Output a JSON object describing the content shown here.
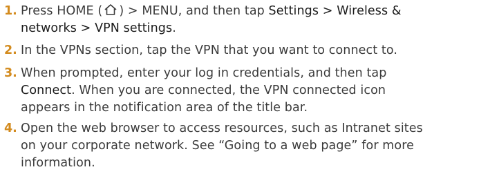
{
  "heading_fragment": "",
  "steps": [
    {
      "number": "1.",
      "line1": {
        "a": "Press HOME (",
        "icon": "home-icon",
        "b": ") > MENU, and then tap ",
        "c": "Settings > Wireless &"
      },
      "line2": {
        "a": "networks > VPN settings",
        "b": "."
      }
    },
    {
      "number": "2.",
      "line1": "In the VPNs section, tap the VPN that you want to connect to."
    },
    {
      "number": "3.",
      "line1": "When prompted, enter your log in credentials, and then tap",
      "line2": {
        "a": "Connect",
        "b": ". When you are connected, the VPN connected icon"
      },
      "line3": "appears in the notification area of the title bar."
    },
    {
      "number": "4.",
      "line1": "Open the web browser to access resources, such as Intranet sites",
      "line2": "on your corporate network. See “Going to a web page” for more",
      "line3": "information."
    }
  ],
  "colors": {
    "step_number": "#d38b1e",
    "body_text": "#3a3a3a",
    "ui_text": "#1a1a1a"
  }
}
